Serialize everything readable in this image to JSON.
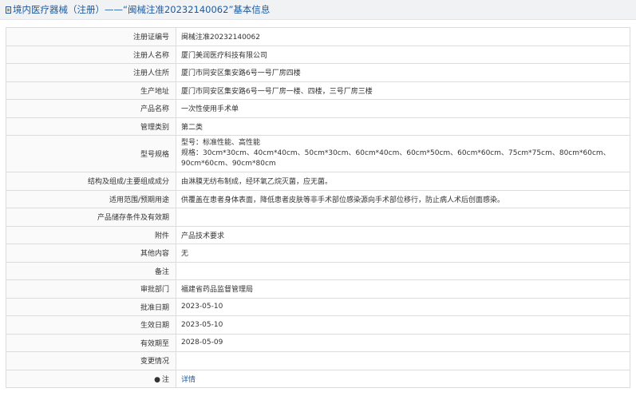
{
  "header": {
    "title": "境内医疗器械（注册）——“闽械注准20232140062”基本信息"
  },
  "rows": [
    {
      "label": "注册证编号",
      "value": "闽械注准20232140062"
    },
    {
      "label": "注册人名称",
      "value": "厦门美润医疗科技有限公司"
    },
    {
      "label": "注册人住所",
      "value": "厦门市同安区集安路6号一号厂房四楼"
    },
    {
      "label": "生产地址",
      "value": "厦门市同安区集安路6号一号厂房一楼、四楼，三号厂房三楼"
    },
    {
      "label": "产品名称",
      "value": "一次性使用手术单"
    },
    {
      "label": "管理类别",
      "value": "第二类"
    },
    {
      "label": "型号规格",
      "value_line1": "型号：标准性能、高性能",
      "value_line2": "规格：30cm*30cm、40cm*40cm、50cm*30cm、60cm*40cm、60cm*50cm、60cm*60cm、75cm*75cm、80cm*60cm、90cm*60cm、90cm*80cm"
    },
    {
      "label": "结构及组成/主要组成成分",
      "value": "由淋膜无纺布制成，经环氧乙烷灭菌，应无菌。"
    },
    {
      "label": "适用范围/预期用途",
      "value": "供覆盖在患者身体表面，降低患者皮肤等非手术部位感染源向手术部位移行，防止病人术后创面感染。"
    },
    {
      "label": "产品储存条件及有效期",
      "value": ""
    },
    {
      "label": "附件",
      "value": "产品技术要求"
    },
    {
      "label": "其他内容",
      "value": "无"
    },
    {
      "label": "备注",
      "value": ""
    },
    {
      "label": "审批部门",
      "value": "福建省药品监督管理局"
    },
    {
      "label": "批准日期",
      "value": "2023-05-10"
    },
    {
      "label": "生效日期",
      "value": "2023-05-10"
    },
    {
      "label": "有效期至",
      "value": "2028-05-09"
    },
    {
      "label": "变更情况",
      "value": ""
    },
    {
      "label": "注",
      "icon": "info-icon",
      "value": "详情"
    }
  ]
}
